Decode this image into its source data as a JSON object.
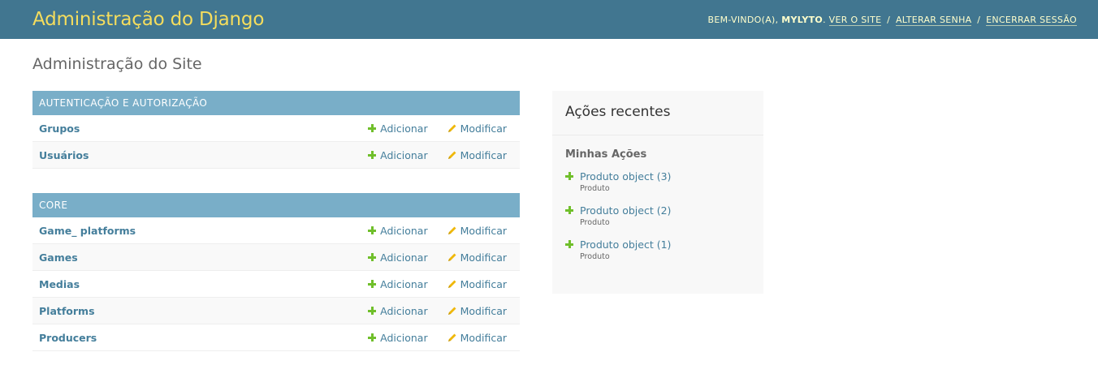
{
  "header": {
    "branding": "Administração do Django",
    "welcome_prefix": "Bem-vindo(a),",
    "username": "MYLYTO",
    "period": ".",
    "view_site": "Ver o site",
    "change_password": "Alterar senha",
    "logout": "Encerrar sessão",
    "separator": "/"
  },
  "page": {
    "title": "Administração do Site"
  },
  "modules": [
    {
      "caption": "Autenticação e Autorização",
      "models": [
        {
          "name": "Grupos",
          "add": "Adicionar",
          "change": "Modificar"
        },
        {
          "name": "Usuários",
          "add": "Adicionar",
          "change": "Modificar"
        }
      ]
    },
    {
      "caption": "Core",
      "models": [
        {
          "name": "Game_ platforms",
          "add": "Adicionar",
          "change": "Modificar"
        },
        {
          "name": "Games",
          "add": "Adicionar",
          "change": "Modificar"
        },
        {
          "name": "Medias",
          "add": "Adicionar",
          "change": "Modificar"
        },
        {
          "name": "Platforms",
          "add": "Adicionar",
          "change": "Modificar"
        },
        {
          "name": "Producers",
          "add": "Adicionar",
          "change": "Modificar"
        }
      ]
    }
  ],
  "sidebar": {
    "title": "Ações recentes",
    "subtitle": "Minhas Ações",
    "items": [
      {
        "title": "Produto object (3)",
        "type": "Produto",
        "icon": "plus-icon"
      },
      {
        "title": "Produto object (2)",
        "type": "Produto",
        "icon": "plus-icon"
      },
      {
        "title": "Produto object (1)",
        "type": "Produto",
        "icon": "plus-icon"
      }
    ]
  },
  "colors": {
    "header_bg": "#417690",
    "branding": "#f5dd5d",
    "caption_bg": "#79aec8",
    "link": "#447e9b",
    "add_icon": "#70bf2b",
    "change_icon": "#efb80b"
  }
}
